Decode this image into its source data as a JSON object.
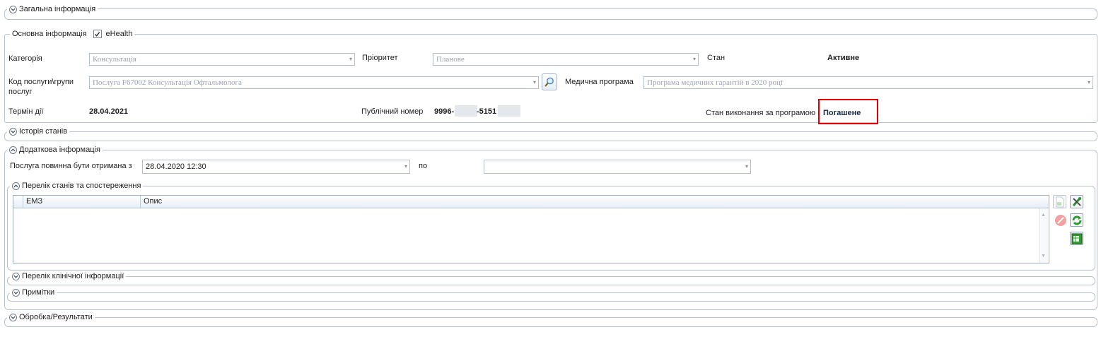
{
  "sections": {
    "general": "Загальна інформація",
    "main_info": "Основна інформація",
    "ehealth": "eHealth",
    "history": "Історія станів",
    "additional": "Додаткова інформація",
    "conditions": "Перелік станів та спостереження",
    "clinical": "Перелік клінічної інформації",
    "notes": "Примітки",
    "processing": "Обробка/Результати"
  },
  "ehealth_checked": true,
  "labels": {
    "category": "Категорія",
    "priority": "Пріоритет",
    "state": "Стан",
    "service_code_1": "Код послуги\\групи",
    "service_code_2": "послуг",
    "medical_program": "Медична програма",
    "term": "Термін дії",
    "public_number": "Публічний номер",
    "program_state": "Стан виконання за програмою",
    "service_from": "Послуга повинна бути отримана з",
    "to": "по"
  },
  "values": {
    "category": "Консультація",
    "priority": "Планове",
    "state": "Активне",
    "service_code": "Послуга F67002 Консультація Офтальмолога",
    "medical_program": "Програма медичних гарантій в 2020 році",
    "term": "28.04.2021",
    "public_number_a": "9996-",
    "public_number_b": "-5151",
    "program_state": "Погашене",
    "service_from": "28.04.2020 12:30",
    "service_to": ""
  },
  "grid": {
    "columns": [
      "ЕМЗ",
      "Опис"
    ],
    "rows": []
  },
  "icons": {
    "expand": "chevron-down-icon",
    "collapse": "chevron-up-icon",
    "search": "magnifier-icon"
  }
}
